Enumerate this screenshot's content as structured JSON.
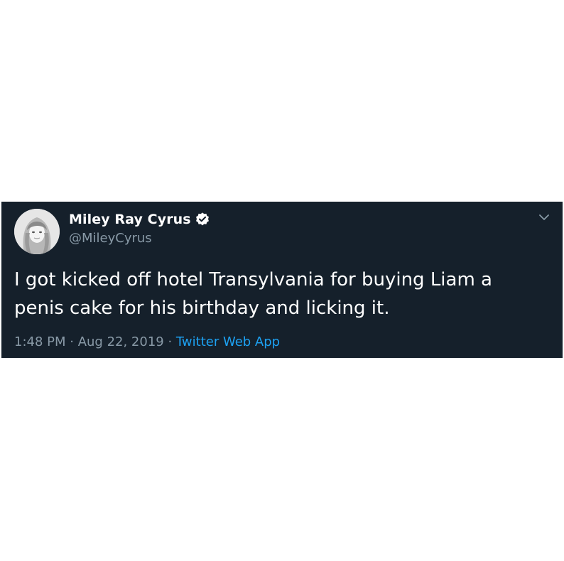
{
  "tweet": {
    "display_name": "Miley Ray Cyrus",
    "handle": "@MileyCyrus",
    "text": "I got kicked off hotel Transylvania for buying Liam a penis cake for his birthday and licking it.",
    "time": "1:48 PM",
    "separator": " · ",
    "date": "Aug 22, 2019",
    "source": "Twitter Web App",
    "verified": true,
    "avatar_icon": "profile-photo",
    "menu_icon": "chevron-down-icon"
  },
  "colors": {
    "background": "#15202b",
    "text": "#ffffff",
    "secondary_text": "#8899a6",
    "link": "#1da1f2"
  }
}
